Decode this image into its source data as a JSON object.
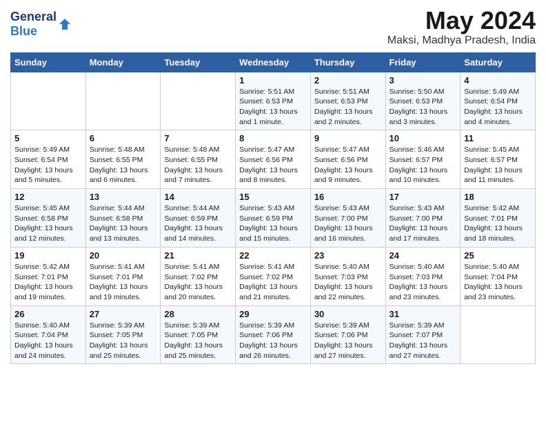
{
  "header": {
    "logo_general": "General",
    "logo_blue": "Blue",
    "month_year": "May 2024",
    "location": "Maksi, Madhya Pradesh, India"
  },
  "weekdays": [
    "Sunday",
    "Monday",
    "Tuesday",
    "Wednesday",
    "Thursday",
    "Friday",
    "Saturday"
  ],
  "weeks": [
    [
      {
        "day": "",
        "info": ""
      },
      {
        "day": "",
        "info": ""
      },
      {
        "day": "",
        "info": ""
      },
      {
        "day": "1",
        "info": "Sunrise: 5:51 AM\nSunset: 6:53 PM\nDaylight: 13 hours\nand 1 minute."
      },
      {
        "day": "2",
        "info": "Sunrise: 5:51 AM\nSunset: 6:53 PM\nDaylight: 13 hours\nand 2 minutes."
      },
      {
        "day": "3",
        "info": "Sunrise: 5:50 AM\nSunset: 6:53 PM\nDaylight: 13 hours\nand 3 minutes."
      },
      {
        "day": "4",
        "info": "Sunrise: 5:49 AM\nSunset: 6:54 PM\nDaylight: 13 hours\nand 4 minutes."
      }
    ],
    [
      {
        "day": "5",
        "info": "Sunrise: 5:49 AM\nSunset: 6:54 PM\nDaylight: 13 hours\nand 5 minutes."
      },
      {
        "day": "6",
        "info": "Sunrise: 5:48 AM\nSunset: 6:55 PM\nDaylight: 13 hours\nand 6 minutes."
      },
      {
        "day": "7",
        "info": "Sunrise: 5:48 AM\nSunset: 6:55 PM\nDaylight: 13 hours\nand 7 minutes."
      },
      {
        "day": "8",
        "info": "Sunrise: 5:47 AM\nSunset: 6:56 PM\nDaylight: 13 hours\nand 8 minutes."
      },
      {
        "day": "9",
        "info": "Sunrise: 5:47 AM\nSunset: 6:56 PM\nDaylight: 13 hours\nand 9 minutes."
      },
      {
        "day": "10",
        "info": "Sunrise: 5:46 AM\nSunset: 6:57 PM\nDaylight: 13 hours\nand 10 minutes."
      },
      {
        "day": "11",
        "info": "Sunrise: 5:45 AM\nSunset: 6:57 PM\nDaylight: 13 hours\nand 11 minutes."
      }
    ],
    [
      {
        "day": "12",
        "info": "Sunrise: 5:45 AM\nSunset: 6:58 PM\nDaylight: 13 hours\nand 12 minutes."
      },
      {
        "day": "13",
        "info": "Sunrise: 5:44 AM\nSunset: 6:58 PM\nDaylight: 13 hours\nand 13 minutes."
      },
      {
        "day": "14",
        "info": "Sunrise: 5:44 AM\nSunset: 6:59 PM\nDaylight: 13 hours\nand 14 minutes."
      },
      {
        "day": "15",
        "info": "Sunrise: 5:43 AM\nSunset: 6:59 PM\nDaylight: 13 hours\nand 15 minutes."
      },
      {
        "day": "16",
        "info": "Sunrise: 5:43 AM\nSunset: 7:00 PM\nDaylight: 13 hours\nand 16 minutes."
      },
      {
        "day": "17",
        "info": "Sunrise: 5:43 AM\nSunset: 7:00 PM\nDaylight: 13 hours\nand 17 minutes."
      },
      {
        "day": "18",
        "info": "Sunrise: 5:42 AM\nSunset: 7:01 PM\nDaylight: 13 hours\nand 18 minutes."
      }
    ],
    [
      {
        "day": "19",
        "info": "Sunrise: 5:42 AM\nSunset: 7:01 PM\nDaylight: 13 hours\nand 19 minutes."
      },
      {
        "day": "20",
        "info": "Sunrise: 5:41 AM\nSunset: 7:01 PM\nDaylight: 13 hours\nand 19 minutes."
      },
      {
        "day": "21",
        "info": "Sunrise: 5:41 AM\nSunset: 7:02 PM\nDaylight: 13 hours\nand 20 minutes."
      },
      {
        "day": "22",
        "info": "Sunrise: 5:41 AM\nSunset: 7:02 PM\nDaylight: 13 hours\nand 21 minutes."
      },
      {
        "day": "23",
        "info": "Sunrise: 5:40 AM\nSunset: 7:03 PM\nDaylight: 13 hours\nand 22 minutes."
      },
      {
        "day": "24",
        "info": "Sunrise: 5:40 AM\nSunset: 7:03 PM\nDaylight: 13 hours\nand 23 minutes."
      },
      {
        "day": "25",
        "info": "Sunrise: 5:40 AM\nSunset: 7:04 PM\nDaylight: 13 hours\nand 23 minutes."
      }
    ],
    [
      {
        "day": "26",
        "info": "Sunrise: 5:40 AM\nSunset: 7:04 PM\nDaylight: 13 hours\nand 24 minutes."
      },
      {
        "day": "27",
        "info": "Sunrise: 5:39 AM\nSunset: 7:05 PM\nDaylight: 13 hours\nand 25 minutes."
      },
      {
        "day": "28",
        "info": "Sunrise: 5:39 AM\nSunset: 7:05 PM\nDaylight: 13 hours\nand 25 minutes."
      },
      {
        "day": "29",
        "info": "Sunrise: 5:39 AM\nSunset: 7:06 PM\nDaylight: 13 hours\nand 26 minutes."
      },
      {
        "day": "30",
        "info": "Sunrise: 5:39 AM\nSunset: 7:06 PM\nDaylight: 13 hours\nand 27 minutes."
      },
      {
        "day": "31",
        "info": "Sunrise: 5:39 AM\nSunset: 7:07 PM\nDaylight: 13 hours\nand 27 minutes."
      },
      {
        "day": "",
        "info": ""
      }
    ]
  ]
}
